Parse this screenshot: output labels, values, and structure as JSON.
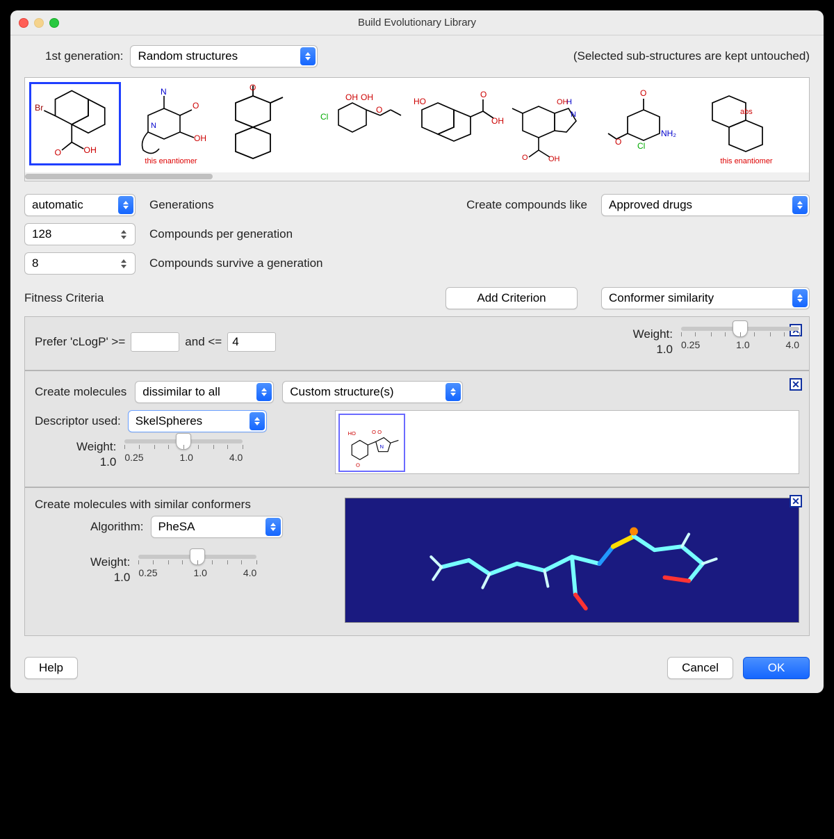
{
  "window": {
    "title": "Build Evolutionary Library"
  },
  "gen_row": {
    "label": "1st generation:",
    "select_value": "Random structures",
    "note": "(Selected sub-structures are kept untouched)",
    "caption_enantiomer": "this enantiomer"
  },
  "params": {
    "generations_label": "Generations",
    "generations_value": "automatic",
    "compounds_like_label": "Create compounds like",
    "compounds_like_value": "Approved drugs",
    "per_gen_label": "Compounds per generation",
    "per_gen_value": "128",
    "survive_label": "Compounds survive a generation",
    "survive_value": "8"
  },
  "fitness": {
    "heading": "Fitness Criteria",
    "add_button": "Add Criterion",
    "type_value": "Conformer similarity"
  },
  "crit1": {
    "prefer_label": "Prefer 'cLogP' >=",
    "and_label": "and <=",
    "min_value": "",
    "max_value": "4",
    "weight_label": "Weight:",
    "weight_value": "1.0",
    "tick_min": "0.25",
    "tick_mid": "1.0",
    "tick_max": "4.0"
  },
  "crit2": {
    "create_label": "Create molecules",
    "mode_value": "dissimilar to all",
    "source_value": "Custom structure(s)",
    "descriptor_label": "Descriptor used:",
    "descriptor_value": "SkelSpheres",
    "weight_label": "Weight:",
    "weight_value": "1.0",
    "tick_min": "0.25",
    "tick_mid": "1.0",
    "tick_max": "4.0"
  },
  "crit3": {
    "create_label": "Create molecules with similar conformers",
    "algo_label": "Algorithm:",
    "algo_value": "PheSA",
    "weight_label": "Weight:",
    "weight_value": "1.0",
    "tick_min": "0.25",
    "tick_mid": "1.0",
    "tick_max": "4.0"
  },
  "footer": {
    "help": "Help",
    "cancel": "Cancel",
    "ok": "OK"
  }
}
